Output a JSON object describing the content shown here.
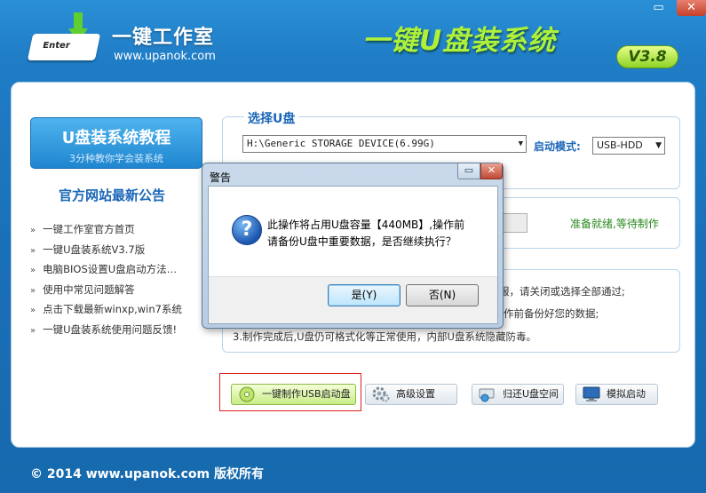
{
  "window": {
    "brand_name": "一键工作室",
    "brand_url": "www.upanok.com",
    "logo_key_text": "Enter",
    "app_title": "一键U盘装系统",
    "version": "V3.8",
    "minimize_glyph": "▭",
    "close_glyph": "✕"
  },
  "sidebar": {
    "tutorial_title": "U盘装系统教程",
    "tutorial_subtitle": "3分种教你学会装系统",
    "news_title": "官方网站最新公告",
    "bullet": "»",
    "news": [
      "一键工作室官方首页",
      "一键U盘装系统V3.7版",
      "电脑BIOS设置U盘启动方法…",
      "使用中常见问题解答",
      "点击下载最新winxp,win7系统",
      "一键U盘装系统使用问题反馈!"
    ]
  },
  "select_group": {
    "legend": "选择U盘",
    "drive_value": "H:\\Generic STORAGE DEVICE(6.99G)",
    "mode_label": "启动模式:",
    "mode_value": "USB-HDD",
    "arrow": "▼"
  },
  "progress": {
    "status": "准备就绪,等待制作"
  },
  "notes": {
    "line1_tail": "服，请关闭或选择全部通过;",
    "line2_tail": "作前备份好您的数据;",
    "line3": "3.制作完成后,U盘仍可格式化等正常使用，内部U盘系统隐藏防毒。"
  },
  "actions": {
    "make": "一键制作USB启动盘",
    "advanced": "高级设置",
    "restore": "归还U盘空间",
    "simulate": "模拟启动"
  },
  "footer": "© 2014 www.upanok.com  版权所有",
  "dialog": {
    "title": "警告",
    "icon_glyph": "?",
    "message_line1": "此操作将占用U盘容量【440MB】,操作前",
    "message_line2": "请备份U盘中重要数据，是否继续执行？",
    "yes": "是(Y)",
    "no": "否(N)",
    "minimize_glyph": "▭",
    "close_glyph": "✕"
  }
}
